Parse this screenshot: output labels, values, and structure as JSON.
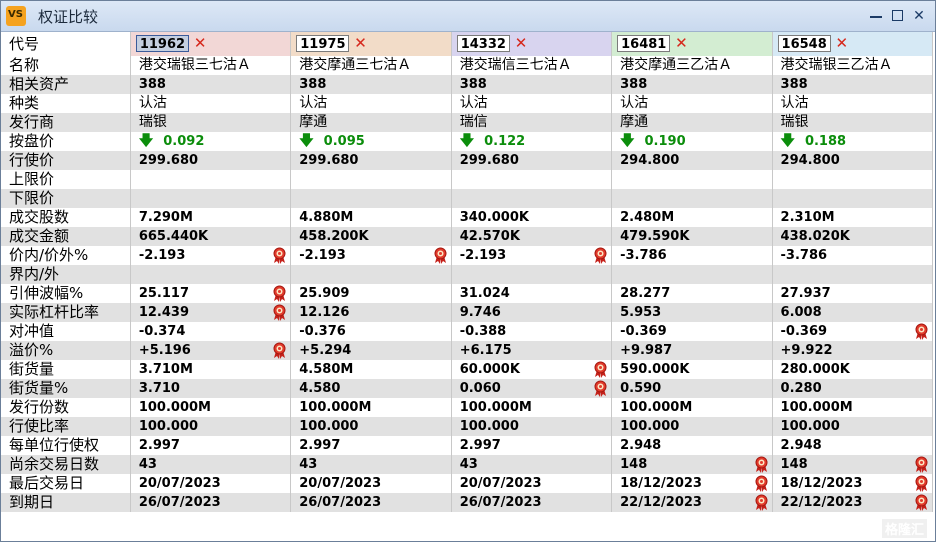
{
  "window": {
    "title": "权证比较",
    "app_icon": "VS"
  },
  "columns": [
    {
      "code": "11962",
      "header_color": "#f2d7d6",
      "selected": true
    },
    {
      "code": "11975",
      "header_color": "#f2dcc8",
      "selected": false
    },
    {
      "code": "14332",
      "header_color": "#d8d4ef",
      "selected": false
    },
    {
      "code": "16481",
      "header_color": "#d3edd2",
      "selected": false
    },
    {
      "code": "16548",
      "header_color": "#d6e9f5",
      "selected": false
    }
  ],
  "rows": [
    {
      "label": "代号",
      "type": "code"
    },
    {
      "label": "名称",
      "type": "cn",
      "values": [
        "港交瑞银三七沽Ａ",
        "港交摩通三七沽Ａ",
        "港交瑞信三七沽Ａ",
        "港交摩通三乙沽Ａ",
        "港交瑞银三乙沽Ａ"
      ]
    },
    {
      "label": "相关资产",
      "type": "num",
      "values": [
        "388",
        "388",
        "388",
        "388",
        "388"
      ]
    },
    {
      "label": "种类",
      "type": "cn",
      "values": [
        "认沽",
        "认沽",
        "认沽",
        "认沽",
        "认沽"
      ]
    },
    {
      "label": "发行商",
      "type": "cn",
      "values": [
        "瑞银",
        "摩通",
        "瑞信",
        "摩通",
        "瑞银"
      ]
    },
    {
      "label": "按盘价",
      "type": "price",
      "values": [
        "0.092",
        "0.095",
        "0.122",
        "0.190",
        "0.188"
      ]
    },
    {
      "label": "行使价",
      "type": "num",
      "values": [
        "299.680",
        "299.680",
        "299.680",
        "294.800",
        "294.800"
      ]
    },
    {
      "label": "上限价",
      "type": "num",
      "values": [
        "",
        "",
        "",
        "",
        ""
      ]
    },
    {
      "label": "下限价",
      "type": "num",
      "values": [
        "",
        "",
        "",
        "",
        ""
      ]
    },
    {
      "label": "成交股数",
      "type": "num",
      "values": [
        "7.290M",
        "4.880M",
        "340.000K",
        "2.480M",
        "2.310M"
      ]
    },
    {
      "label": "成交金额",
      "type": "num",
      "values": [
        "665.440K",
        "458.200K",
        "42.570K",
        "479.590K",
        "438.020K"
      ]
    },
    {
      "label": "价内/价外%",
      "type": "num",
      "values": [
        "-2.193",
        "-2.193",
        "-2.193",
        "-3.786",
        "-3.786"
      ],
      "badges": [
        true,
        true,
        true,
        false,
        false
      ]
    },
    {
      "label": "界内/外",
      "type": "num",
      "values": [
        "",
        "",
        "",
        "",
        ""
      ]
    },
    {
      "label": "引伸波幅%",
      "type": "num",
      "values": [
        "25.117",
        "25.909",
        "31.024",
        "28.277",
        "27.937"
      ],
      "badges": [
        true,
        false,
        false,
        false,
        false
      ]
    },
    {
      "label": "实际杠杆比率",
      "type": "num",
      "values": [
        "12.439",
        "12.126",
        "9.746",
        "5.953",
        "6.008"
      ],
      "badges": [
        true,
        false,
        false,
        false,
        false
      ]
    },
    {
      "label": "对冲值",
      "type": "num",
      "values": [
        "-0.374",
        "-0.376",
        "-0.388",
        "-0.369",
        "-0.369"
      ],
      "badges": [
        false,
        false,
        false,
        false,
        true
      ]
    },
    {
      "label": "溢价%",
      "type": "num",
      "values": [
        "+5.196",
        "+5.294",
        "+6.175",
        "+9.987",
        "+9.922"
      ],
      "badges": [
        true,
        false,
        false,
        false,
        false
      ]
    },
    {
      "label": "街货量",
      "type": "num",
      "values": [
        "3.710M",
        "4.580M",
        "60.000K",
        "590.000K",
        "280.000K"
      ],
      "badges": [
        false,
        false,
        true,
        false,
        false
      ]
    },
    {
      "label": "街货量%",
      "type": "num",
      "values": [
        "3.710",
        "4.580",
        "0.060",
        "0.590",
        "0.280"
      ],
      "badges": [
        false,
        false,
        true,
        false,
        false
      ]
    },
    {
      "label": "发行份数",
      "type": "num",
      "values": [
        "100.000M",
        "100.000M",
        "100.000M",
        "100.000M",
        "100.000M"
      ]
    },
    {
      "label": "行使比率",
      "type": "num",
      "values": [
        "100.000",
        "100.000",
        "100.000",
        "100.000",
        "100.000"
      ]
    },
    {
      "label": "每单位行使权",
      "type": "num",
      "values": [
        "2.997",
        "2.997",
        "2.997",
        "2.948",
        "2.948"
      ]
    },
    {
      "label": "尚余交易日数",
      "type": "num",
      "values": [
        "43",
        "43",
        "43",
        "148",
        "148"
      ],
      "badges": [
        false,
        false,
        false,
        true,
        true
      ]
    },
    {
      "label": "最后交易日",
      "type": "num",
      "values": [
        "20/07/2023",
        "20/07/2023",
        "20/07/2023",
        "18/12/2023",
        "18/12/2023"
      ],
      "badges": [
        false,
        false,
        false,
        true,
        true
      ]
    },
    {
      "label": "到期日",
      "type": "num",
      "values": [
        "26/07/2023",
        "26/07/2023",
        "26/07/2023",
        "22/12/2023",
        "22/12/2023"
      ],
      "badges": [
        false,
        false,
        false,
        true,
        true
      ]
    }
  ],
  "watermark": "格隆汇"
}
